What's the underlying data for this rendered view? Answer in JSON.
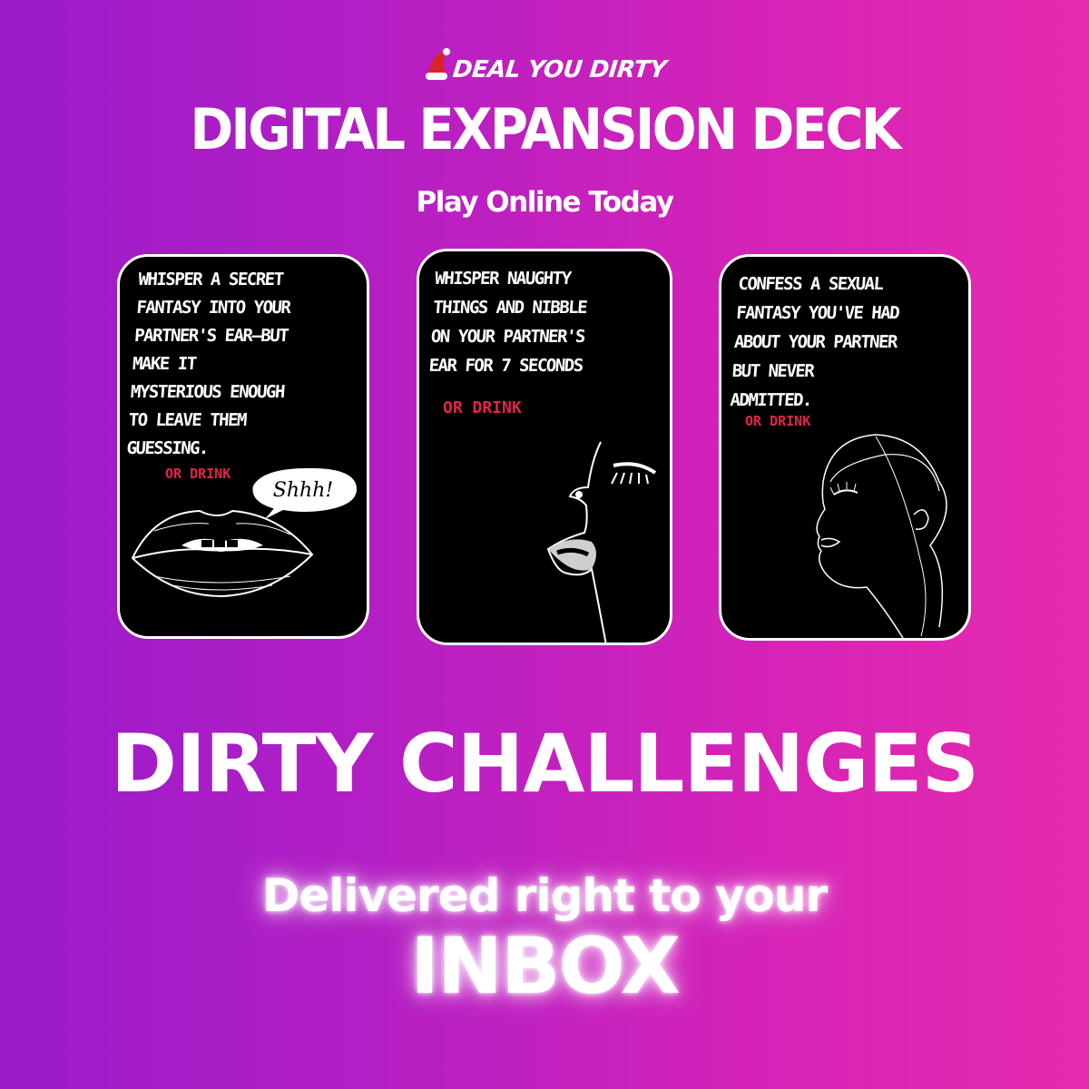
{
  "brand": {
    "logo_text": "DEAL YOU DIRTY",
    "hat_icon": "santa-hat-icon"
  },
  "headline": "DIGITAL EXPANSION DECK",
  "subhead": "Play Online Today",
  "cards": [
    {
      "text": "WHISPER A SECRET\nFANTASY INTO YOUR\nPARTNER'S EAR—BUT\nMAKE IT\nMYSTERIOUS ENOUGH\nTO LEAVE THEM\nGUESSING.",
      "or_drink": "OR DRINK",
      "speech_bubble": "Shhh!",
      "illustration": "lips-icon"
    },
    {
      "text": "WHISPER NAUGHTY\nTHINGS AND NIBBLE\nON YOUR PARTNER'S\nEAR FOR 7 SECONDS",
      "or_drink": "OR DRINK",
      "illustration": "face-profile-lips-icon"
    },
    {
      "text": "CONFESS A SEXUAL\nFANTASY YOU'VE HAD\nABOUT YOUR PARTNER\nBUT NEVER\nADMITTED.",
      "or_drink": "OR DRINK",
      "illustration": "face-line-art-icon"
    }
  ],
  "tagline": "DIRTY CHALLENGES",
  "delivery_line": "Delivered right to your",
  "delivery_emphasis": "INBOX",
  "colors": {
    "background_start": "#9a1bc9",
    "background_end": "#e62aad",
    "card": "#000000",
    "accent_red": "#e4234a"
  }
}
